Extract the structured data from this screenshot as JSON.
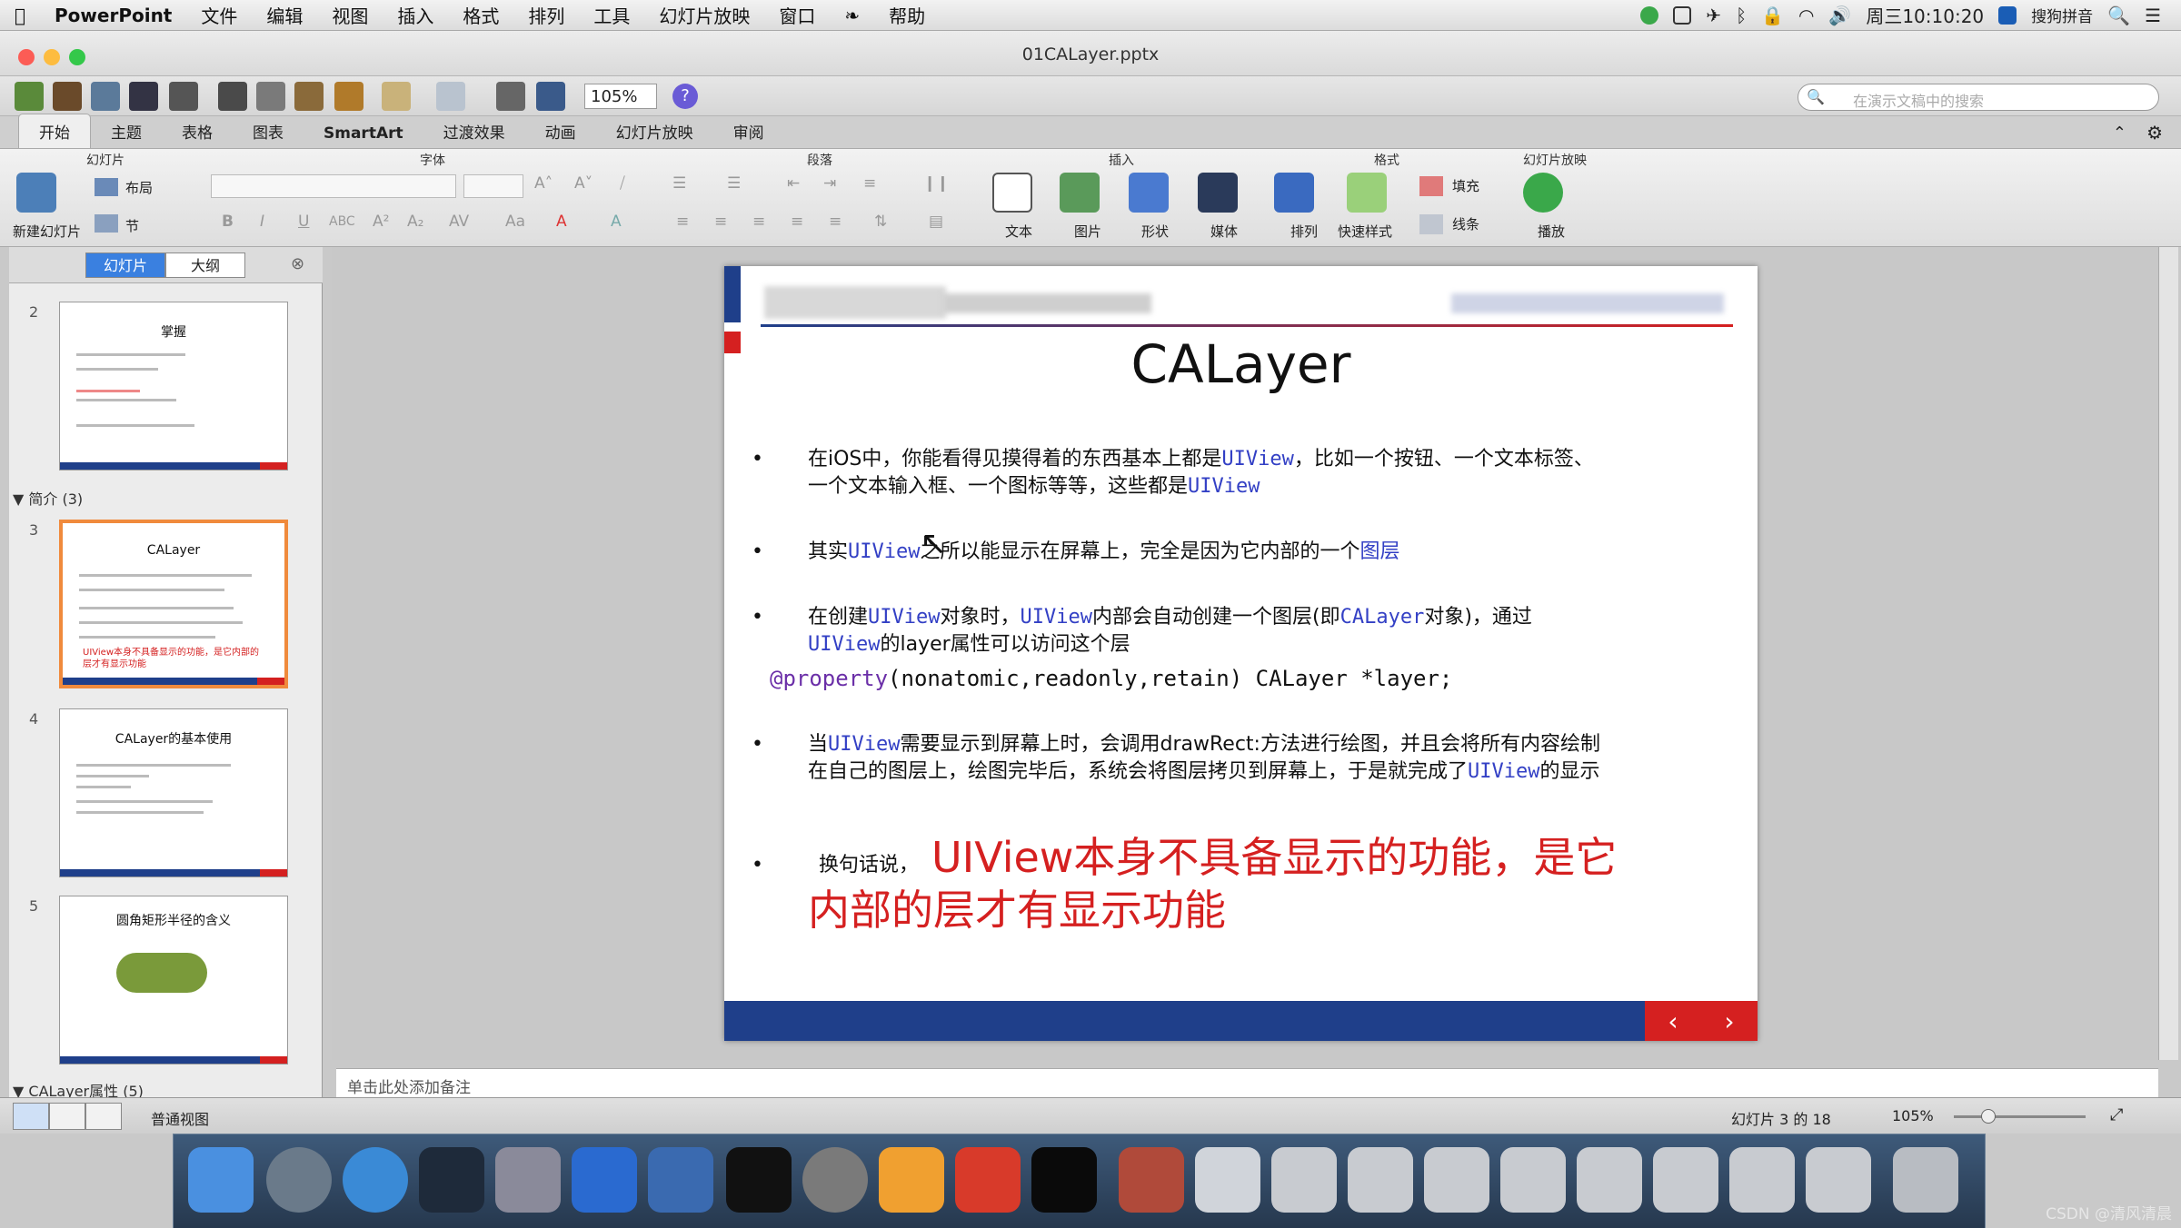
{
  "menubar": {
    "app": "PowerPoint",
    "items": [
      "文件",
      "编辑",
      "视图",
      "插入",
      "格式",
      "排列",
      "工具",
      "幻灯片放映",
      "窗口",
      "帮助"
    ],
    "clock": "周三10:10:20",
    "ime": "搜狗拼音"
  },
  "window": {
    "title": "01CALayer.pptx",
    "zoom": "105%",
    "search_placeholder": "在演示文稿中的搜索"
  },
  "ribbon": {
    "tabs": [
      "开始",
      "主题",
      "表格",
      "图表",
      "SmartArt",
      "过渡效果",
      "动画",
      "幻灯片放映",
      "审阅"
    ],
    "groups": {
      "slides": "幻灯片",
      "font": "字体",
      "paragraph": "段落",
      "insert": "插入",
      "format": "格式",
      "slideshow": "幻灯片放映"
    },
    "new_slide": "新建幻灯片",
    "layout": "布局",
    "section": "节",
    "insert_items": [
      "文本",
      "图片",
      "形状",
      "媒体"
    ],
    "arrange": "排列",
    "quick_styles": "快速样式",
    "fill": "填充",
    "line": "线条",
    "play": "播放"
  },
  "left_pane": {
    "tabs": [
      "幻灯片",
      "大纲"
    ],
    "sections": [
      "简介 (3)",
      "CALayer属性 (5)"
    ],
    "slides": [
      {
        "num": "2",
        "title": "掌握"
      },
      {
        "num": "3",
        "title": "CALayer",
        "caption": "UIView本身不具备显示的功能，是它内部的层才有显示功能"
      },
      {
        "num": "4",
        "title": "CALayer的基本使用"
      },
      {
        "num": "5",
        "title": "圆角矩形半径的含义"
      }
    ]
  },
  "slide": {
    "title": "CALayer",
    "b1a": "在iOS中，你能看得见摸得着的东西基本上都是",
    "b1k": "UIView",
    "b1b": "，比如一个按钮、一个文本标签、",
    "b1c": "一个文本输入框、一个图标等等，这些都是",
    "b1k2": "UIView",
    "b2a": "其实",
    "b2k": "UIView",
    "b2b": "之所以能显示在屏幕上，完全是因为它内部的一个",
    "b2c": "图层",
    "b3a": "在创建",
    "b3k": "UIView",
    "b3b": "对象时，",
    "b3k2": "UIView",
    "b3c": "内部会自动创建一个图层(即",
    "b3k3": "CALayer",
    "b3d": "对象)，通过",
    "b3k4": "UIView",
    "b3e": "的layer属性可以访问这个层",
    "code_prop": "@property",
    "code_rest": "(nonatomic,readonly,retain) CALayer *layer;",
    "b4a": "当",
    "b4k": "UIView",
    "b4b": "需要显示到屏幕上时，会调用drawRect:方法进行绘图，并且会将所有内容绘制",
    "b4c": "在自己的图层上，绘图完毕后，系统会将图层拷贝到屏幕上，于是就完成了",
    "b4k2": "UIView",
    "b4d": "的显示",
    "b5pre": "换句话说，",
    "b5big1": "UIView本身不具备显示的功能，是它",
    "b5big2": "内部的层才有显示功能"
  },
  "notes_placeholder": "单击此处添加备注",
  "status": {
    "view": "普通视图",
    "slide_count": "幻灯片 3 的 18",
    "zoom": "105%"
  },
  "watermark": "CSDN @清风清晨"
}
